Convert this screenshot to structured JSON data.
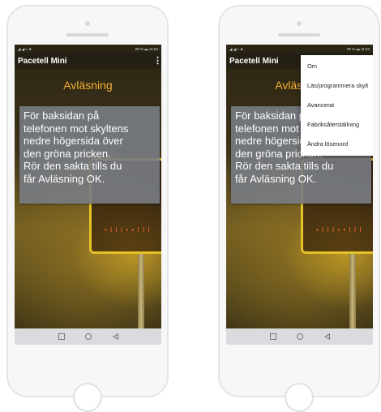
{
  "statusbar": {
    "signal": "◢ ◢ ≈ ★",
    "right": "99 % ▬ 11:54"
  },
  "appbar": {
    "title": "Pacetell Mini",
    "overflow": "⋮"
  },
  "screen": {
    "heading": "Avläsning",
    "sign_digits": "• I I I • • I I I",
    "message_lines": [
      "För baksidan på",
      "telefonen mot skyltens",
      "nedre högersida över",
      "den gröna pricken.",
      "Rör den sakta tills du",
      "får Avläsning OK."
    ]
  },
  "menu": {
    "items": [
      "Om",
      "Läs/programmera skylt",
      "Avancerat",
      "Fabriksåterställning",
      "Ändra lösenord"
    ]
  },
  "colors": {
    "heading": "#f7b233",
    "message_bg": "#787c84",
    "sign_frame": "#e5c227"
  }
}
